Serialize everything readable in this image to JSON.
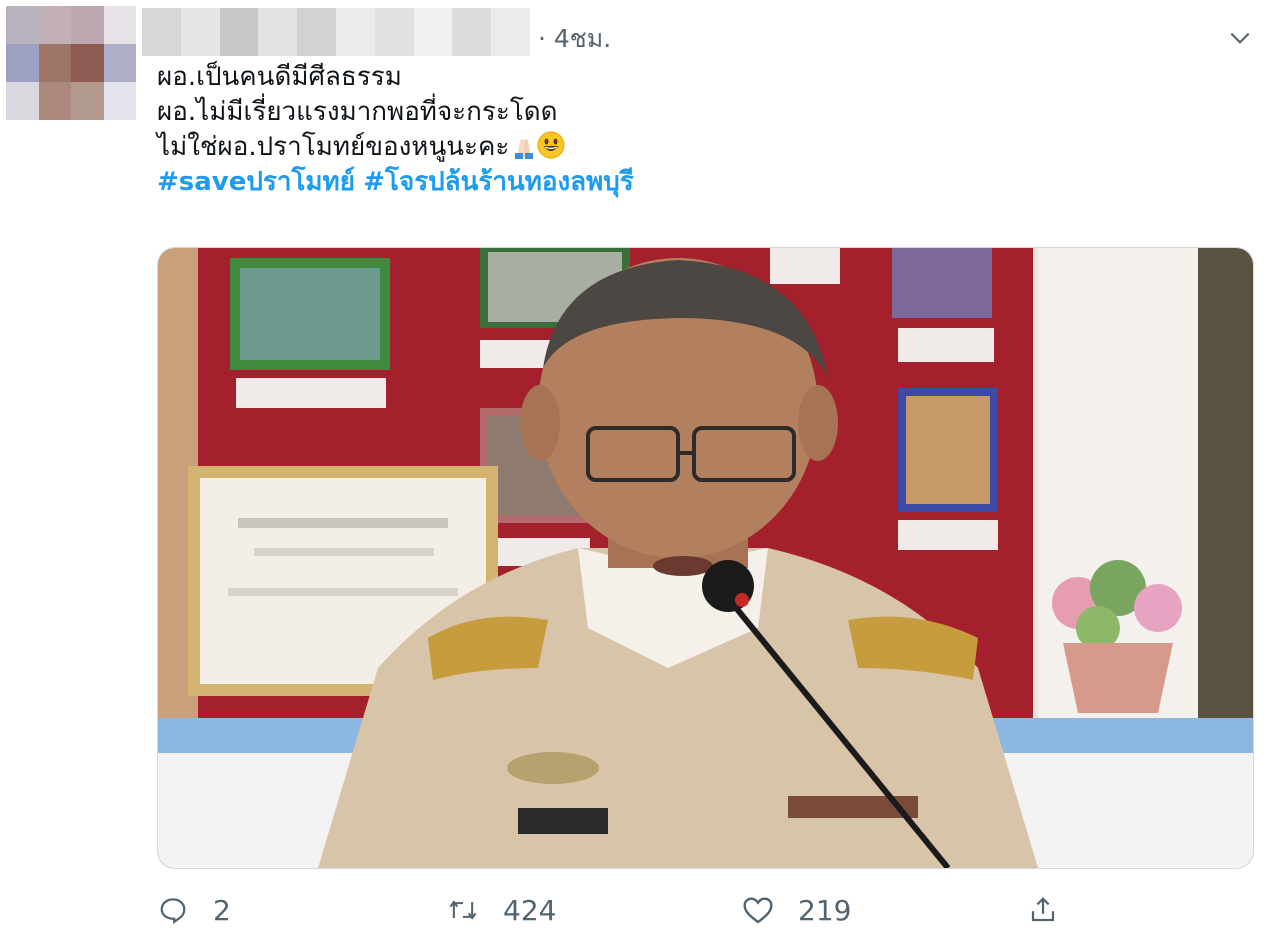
{
  "tweet": {
    "timestamp": "· 4ชม.",
    "lines": [
      "ผอ.เป็นคนดีมีศีลธรรม",
      "ผอ.ไม่มีเรี่ยวแรงมากพอที่จะกระโดด",
      "ไม่ใช่ผอ.ปราโมทย์ของหนูนะคะ"
    ],
    "hashtags": [
      "#saveปราโมทย์",
      "#โจรปล้นร้านทองลพบุรี"
    ],
    "emojis": [
      "folded-hands-emoji",
      "grinning-face-emoji"
    ]
  },
  "actions": {
    "reply_count": "2",
    "retweet_count": "424",
    "like_count": "219"
  },
  "colors": {
    "hashtag": "#1d9bf0",
    "meta_text": "#536471",
    "text": "#0f1419"
  },
  "icons": {
    "more": "chevron-down-icon",
    "reply": "reply-icon",
    "retweet": "retweet-icon",
    "like": "heart-icon",
    "share": "share-icon"
  }
}
